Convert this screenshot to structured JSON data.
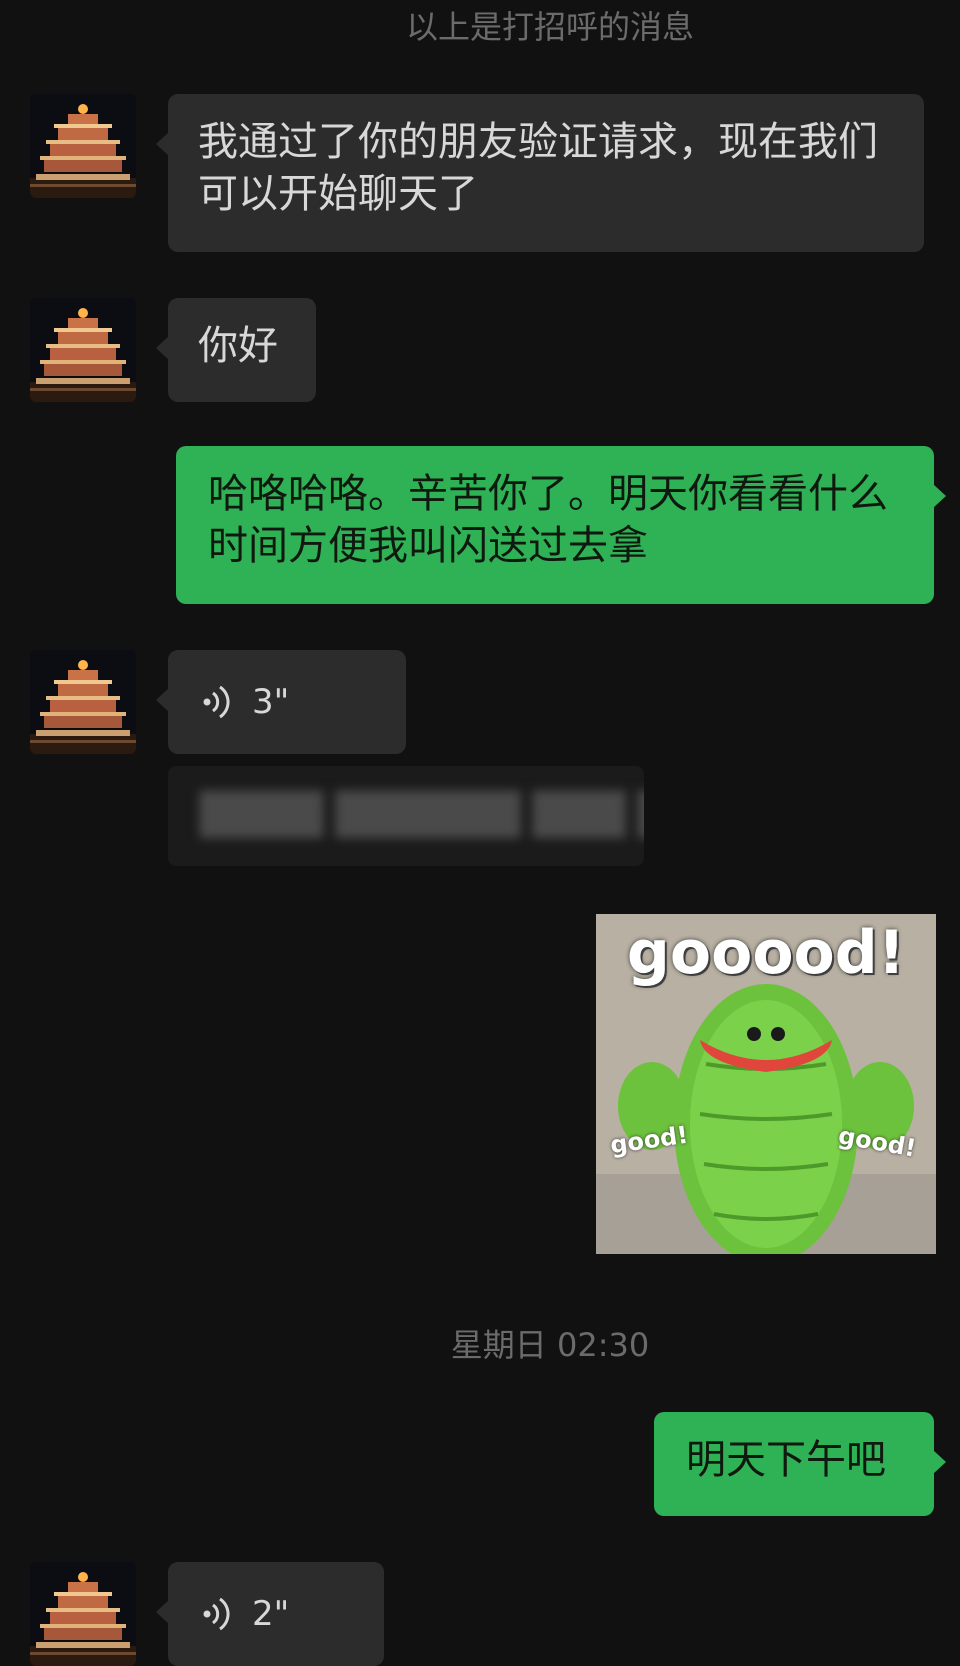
{
  "system_message": "以上是打招呼的消息",
  "messages": [
    {
      "direction": "incoming",
      "type": "text",
      "text": "我通过了你的朋友验证请求，现在我们可以开始聊天了"
    },
    {
      "direction": "incoming",
      "type": "text",
      "text": "你好"
    },
    {
      "direction": "outgoing",
      "type": "text",
      "text": "哈咯哈咯。辛苦你了。明天你看看什么时间方便我叫闪送过去拿"
    },
    {
      "direction": "incoming",
      "type": "voice",
      "duration": "3\""
    },
    {
      "direction": "incoming",
      "type": "text",
      "blurred": true,
      "text": ""
    },
    {
      "direction": "outgoing",
      "type": "sticker",
      "sticker": {
        "title": "gooood!",
        "left_label": "good!",
        "right_label": "good!"
      }
    },
    {
      "direction": "outgoing",
      "type": "text",
      "text": "明天下午吧"
    },
    {
      "direction": "incoming",
      "type": "voice",
      "duration": "2\""
    }
  ],
  "timestamp": "星期日 02:30",
  "colors": {
    "background": "#111111",
    "incoming_bubble": "#2c2c2c",
    "outgoing_bubble": "#2fb155",
    "system_text": "#6b6b6b"
  },
  "icons": {
    "voice": "voice-wave-icon",
    "avatar": "pagoda-night-avatar"
  }
}
